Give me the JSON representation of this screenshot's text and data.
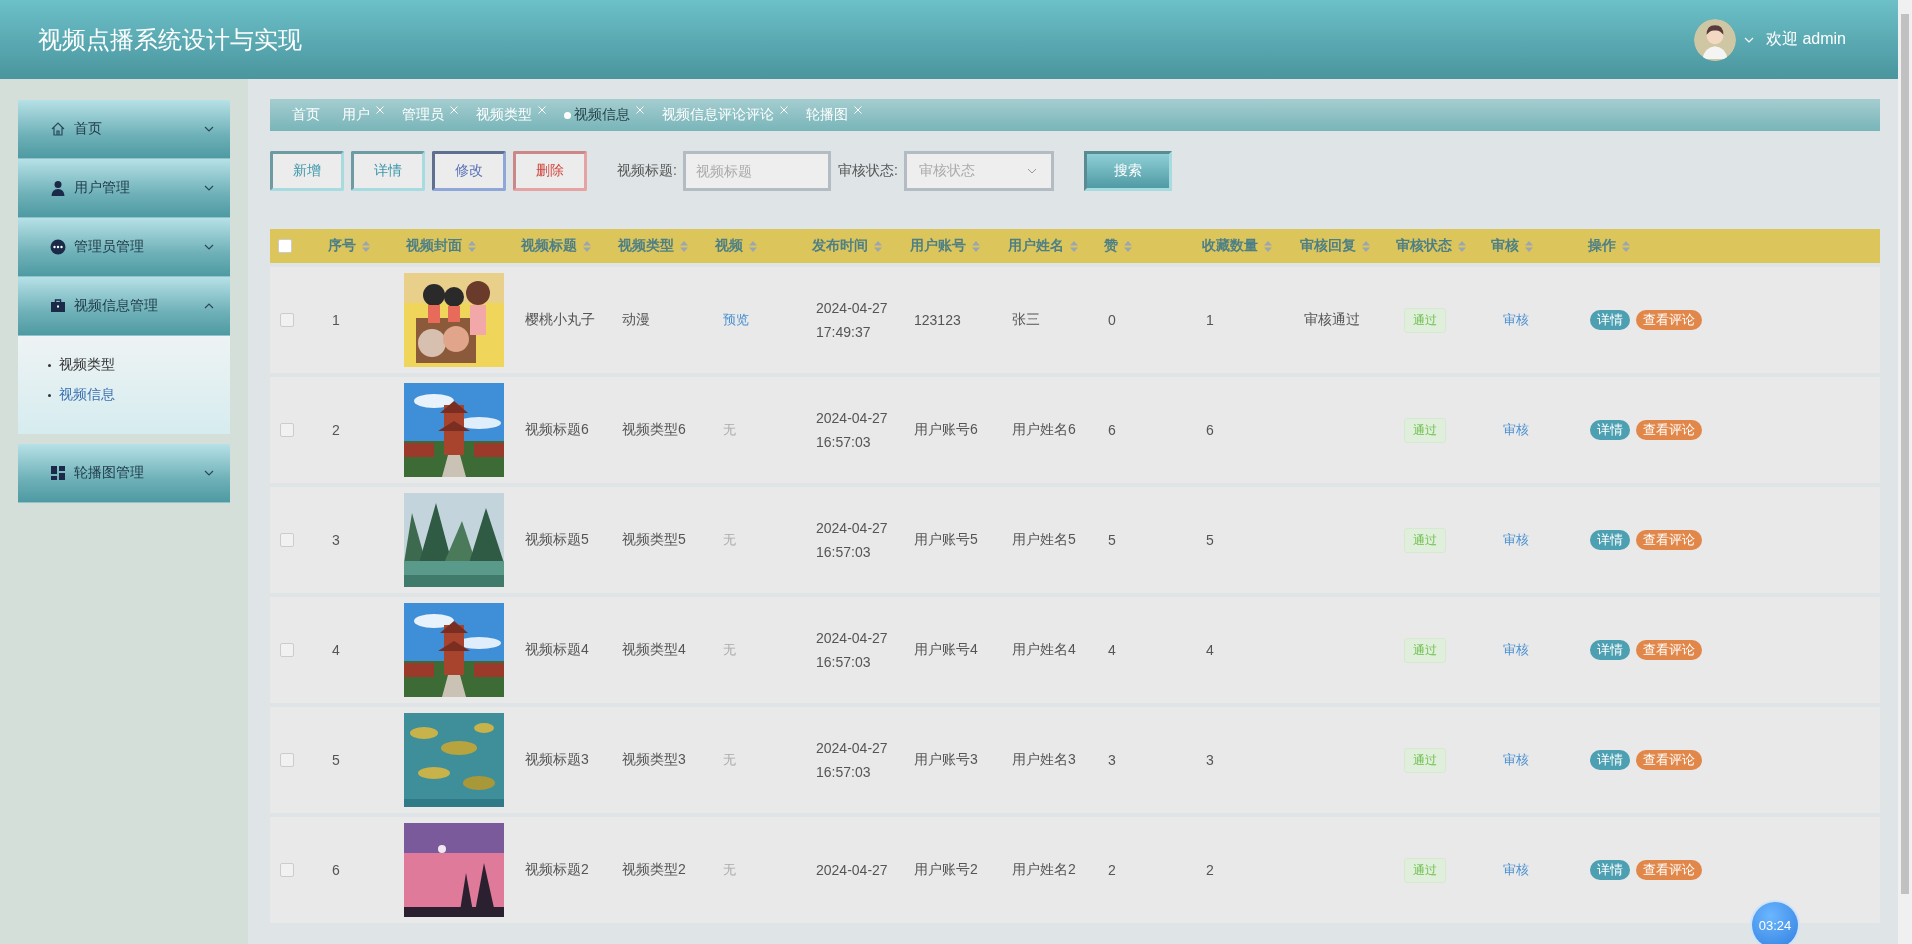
{
  "header": {
    "title": "视频点播系统设计与实现",
    "welcome": "欢迎 admin"
  },
  "sidebar": {
    "items": [
      {
        "label": "首页",
        "expanded": false
      },
      {
        "label": "用户管理",
        "expanded": false
      },
      {
        "label": "管理员管理",
        "expanded": false
      },
      {
        "label": "视频信息管理",
        "expanded": true,
        "children": [
          {
            "label": "视频类型",
            "selected": false
          },
          {
            "label": "视频信息",
            "selected": true
          }
        ]
      },
      {
        "label": "轮播图管理",
        "expanded": false
      }
    ]
  },
  "tabs": [
    {
      "label": "首页",
      "selected": false,
      "closable": false
    },
    {
      "label": "用户",
      "selected": false,
      "closable": true
    },
    {
      "label": "管理员",
      "selected": false,
      "closable": true
    },
    {
      "label": "视频类型",
      "selected": false,
      "closable": true
    },
    {
      "label": "视频信息",
      "selected": true,
      "closable": true
    },
    {
      "label": "视频信息评论评论",
      "selected": false,
      "closable": true
    },
    {
      "label": "轮播图",
      "selected": false,
      "closable": true
    }
  ],
  "toolbar": {
    "buttons": [
      {
        "label": "新增",
        "kind": "add"
      },
      {
        "label": "详情",
        "kind": "detail"
      },
      {
        "label": "修改",
        "kind": "edit"
      },
      {
        "label": "删除",
        "kind": "delete"
      }
    ],
    "title_filter": {
      "label": "视频标题:",
      "placeholder": "视频标题"
    },
    "status_filter": {
      "label": "审核状态:",
      "placeholder": "审核状态"
    },
    "search_button": "搜索"
  },
  "table": {
    "select_all": false,
    "columns": [
      "序号",
      "视频封面",
      "视频标题",
      "视频类型",
      "视频",
      "发布时间",
      "用户账号",
      "用户姓名",
      "赞",
      "收藏数量",
      "审核回复",
      "审核状态",
      "审核",
      "操作"
    ],
    "rows": [
      {
        "checked": false,
        "seq": "1",
        "title": "樱桃小丸子",
        "type": "动漫",
        "video": {
          "text": "预览",
          "kind": "link"
        },
        "date": "2024-04-27",
        "time": "17:49:37",
        "account": "123123",
        "name": "张三",
        "likes": "0",
        "favorites": "1",
        "reply": "审核通过",
        "status": "通过",
        "audit": "审核",
        "actions": [
          "详情",
          "查看评论"
        ]
      },
      {
        "checked": false,
        "seq": "2",
        "title": "视频标题6",
        "type": "视频类型6",
        "video": {
          "text": "无",
          "kind": "none"
        },
        "date": "2024-04-27",
        "time": "16:57:03",
        "account": "用户账号6",
        "name": "用户姓名6",
        "likes": "6",
        "favorites": "6",
        "status": "通过",
        "audit": "审核",
        "actions": [
          "详情",
          "查看评论"
        ]
      },
      {
        "checked": false,
        "seq": "3",
        "title": "视频标题5",
        "type": "视频类型5",
        "video": {
          "text": "无",
          "kind": "none"
        },
        "date": "2024-04-27",
        "time": "16:57:03",
        "account": "用户账号5",
        "name": "用户姓名5",
        "likes": "5",
        "favorites": "5",
        "status": "通过",
        "audit": "审核",
        "actions": [
          "详情",
          "查看评论"
        ]
      },
      {
        "checked": false,
        "seq": "4",
        "title": "视频标题4",
        "type": "视频类型4",
        "video": {
          "text": "无",
          "kind": "none"
        },
        "date": "2024-04-27",
        "time": "16:57:03",
        "account": "用户账号4",
        "name": "用户姓名4",
        "likes": "4",
        "favorites": "4",
        "status": "通过",
        "audit": "审核",
        "actions": [
          "详情",
          "查看评论"
        ]
      },
      {
        "checked": false,
        "seq": "5",
        "title": "视频标题3",
        "type": "视频类型3",
        "video": {
          "text": "无",
          "kind": "none"
        },
        "date": "2024-04-27",
        "time": "16:57:03",
        "account": "用户账号3",
        "name": "用户姓名3",
        "likes": "3",
        "favorites": "3",
        "status": "通过",
        "audit": "审核",
        "actions": [
          "详情",
          "查看评论"
        ]
      },
      {
        "checked": false,
        "seq": "6",
        "title": "视频标题2",
        "type": "视频类型2",
        "video": {
          "text": "无",
          "kind": "none"
        },
        "date": "2024-04-27",
        "account": "用户账号2",
        "name": "用户姓名2",
        "likes": "2",
        "favorites": "2",
        "status": "通过",
        "audit": "审核",
        "actions": [
          "详情",
          "查看评论"
        ]
      }
    ]
  },
  "timer": "03:24"
}
